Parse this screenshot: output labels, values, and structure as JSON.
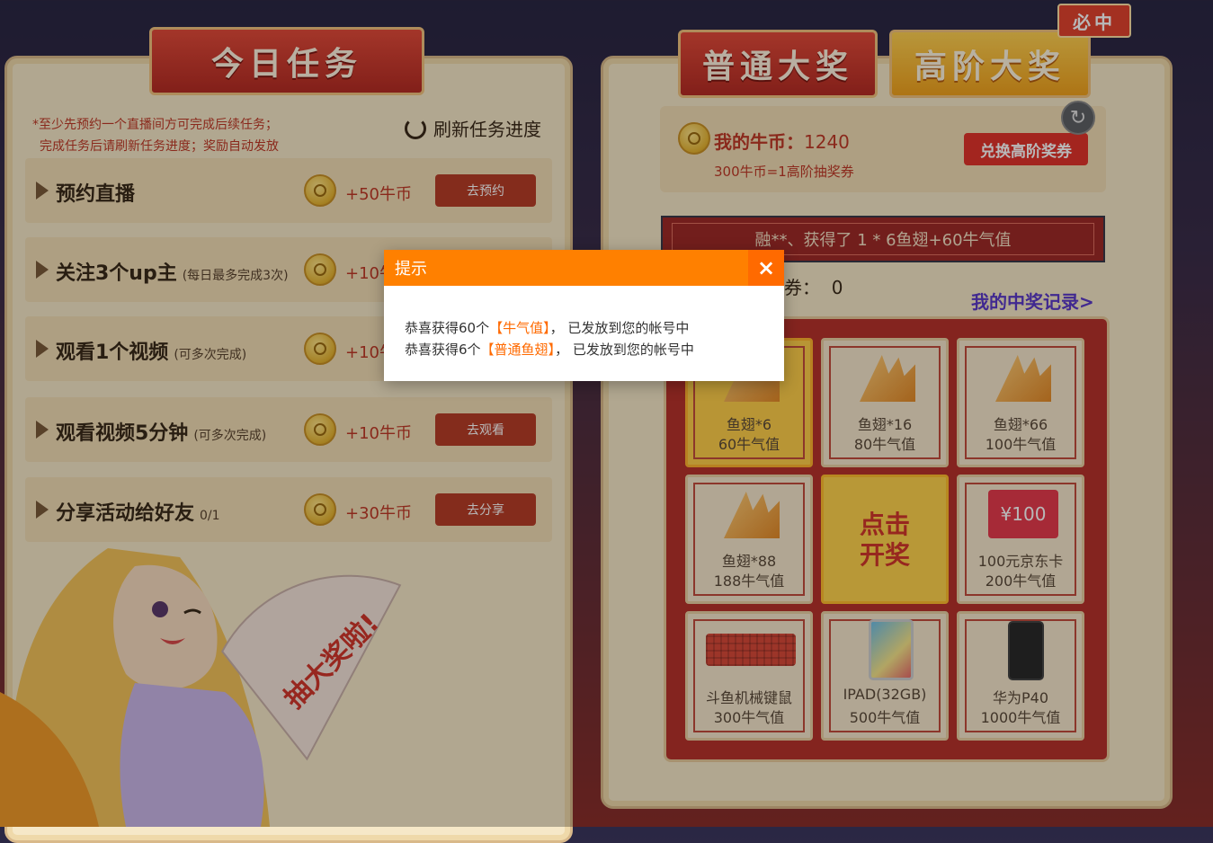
{
  "left": {
    "banner": "今日任务",
    "notes": [
      "*至少先预约一个直播间方可完成后续任务；",
      "完成任务后请刷新任务进度；奖励自动发放"
    ],
    "refresh_label": "刷新任务进度",
    "tasks": [
      {
        "title": "预约直播",
        "sub": "",
        "reward": "+50牛币",
        "button": "去预约"
      },
      {
        "title": "关注3个up主",
        "sub": "(每日最多完成3次)",
        "reward": "+10牛币",
        "button": ""
      },
      {
        "title": "观看1个视频",
        "sub": "(可多次完成)",
        "reward": "+10牛币",
        "button": ""
      },
      {
        "title": "观看视频5分钟",
        "sub": "(可多次完成)",
        "reward": "+10牛币",
        "button": "去观看"
      },
      {
        "title": "分享活动给好友",
        "sub": "0/1",
        "reward": "+30牛币",
        "button": "去分享"
      }
    ],
    "fan_text": "抽大奖啦!"
  },
  "right": {
    "banner_normal": "普通大奖",
    "banner_high": "高阶大奖",
    "badge": "必中",
    "coin_label": "我的牛币：",
    "coin_value": "1240",
    "coin_rate": "300牛币=1高阶抽奖券",
    "exchange_button": "兑换高阶奖券",
    "ticker": "融**、获得了 1 * 6鱼翅+60牛气值",
    "tickets_label": "券：",
    "tickets_value": "0",
    "record_link": "我的中奖记录>",
    "prizes": [
      {
        "name": "鱼翅*6",
        "value": "60牛气值",
        "icon": "fin-icon"
      },
      {
        "name": "鱼翅*16",
        "value": "80牛气值",
        "icon": "fin-icon"
      },
      {
        "name": "鱼翅*66",
        "value": "100牛气值",
        "icon": "fin-icon"
      },
      {
        "name": "鱼翅*88",
        "value": "188牛气值",
        "icon": "fin-icon"
      },
      {
        "name": "100元京东卡",
        "value": "200牛气值",
        "icon": "jd-card-icon",
        "card_text": "¥100"
      },
      {
        "name": "斗鱼机械键鼠",
        "value": "300牛气值",
        "icon": "keyboard-icon"
      },
      {
        "name": "IPAD(32GB)",
        "value": "500牛气值",
        "icon": "ipad-icon"
      },
      {
        "name": "华为P40",
        "value": "1000牛气值",
        "icon": "phone-icon"
      }
    ],
    "draw_button": [
      "点击",
      "开奖"
    ]
  },
  "modal": {
    "title": "提示",
    "close": "×",
    "line1_pre": "恭喜获得60个",
    "line1_hl": "【牛气值】",
    "line1_post": "， 已发放到您的帐号中",
    "line2_pre": "恭喜获得6个",
    "line2_hl": "【普通鱼翅】",
    "line2_post": "， 已发放到您的帐号中"
  },
  "colors": {
    "accent": "#ff8000",
    "red": "#c03a28",
    "panel": "#f6e8c8"
  }
}
